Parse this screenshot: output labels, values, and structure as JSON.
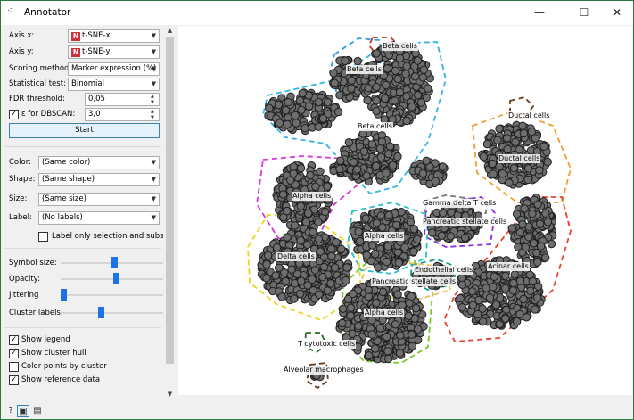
{
  "window": {
    "title": "Annotator",
    "minimize": "—",
    "maximize": "☐",
    "close": "✕"
  },
  "controls": {
    "axis_x": {
      "label": "Axis x:",
      "value": "t-SNE-x"
    },
    "axis_y": {
      "label": "Axis y:",
      "value": "t-SNE-y"
    },
    "scoring_method": {
      "label": "Scoring method:",
      "value": "Marker expression (%)"
    },
    "statistical_test": {
      "label": "Statistical test:",
      "value": "Binomial"
    },
    "fdr_threshold": {
      "label": "FDR threshold:",
      "value": "0,05"
    },
    "epsilon": {
      "label": "ε for DBSCAN:",
      "value": "3,0",
      "checked": true
    },
    "start_label": "Start"
  },
  "appearance": {
    "color": {
      "label": "Color:",
      "value": "(Same color)"
    },
    "shape": {
      "label": "Shape:",
      "value": "(Same shape)"
    },
    "size": {
      "label": "Size:",
      "value": "(Same size)"
    },
    "label": {
      "label": "Label:",
      "value": "(No labels)"
    },
    "label_only_selection": {
      "label": "Label only selection and subset",
      "checked": false
    }
  },
  "sliders": {
    "symbol_size": {
      "label": "Symbol size:",
      "level": 0.5
    },
    "opacity": {
      "label": "Opacity:",
      "level": 0.52
    },
    "jittering": {
      "label": "Jittering",
      "level": 0.0
    },
    "cluster_labels": {
      "label": "Cluster labels:",
      "level": 0.37
    }
  },
  "options": {
    "show_legend": {
      "label": "Show legend",
      "checked": true
    },
    "show_cluster_hull": {
      "label": "Show cluster hull",
      "checked": true
    },
    "color_points_by_cluster": {
      "label": "Color points by cluster",
      "checked": false
    },
    "show_reference_data": {
      "label": "Show reference data",
      "checked": true
    }
  },
  "bottom_icons": [
    "help-icon",
    "save-icon",
    "report-icon"
  ],
  "clusters": [
    {
      "name": "Beta cells",
      "hull_color": "#c0392b"
    },
    {
      "name": "Beta cells",
      "hull_color": "#2e9fd9"
    },
    {
      "name": "Beta cells",
      "hull_color": "#34b6e0"
    },
    {
      "name": "Ductal cells",
      "hull_color": "#6e3b1e"
    },
    {
      "name": "Ductal cells",
      "hull_color": "#f0a030"
    },
    {
      "name": "Alpha cells",
      "hull_color": "#d63ad6"
    },
    {
      "name": "Gamma delta T cells",
      "hull_color": "#7a7a7a"
    },
    {
      "name": "Pancreatic stellate cells",
      "hull_color": "#8b2be2"
    },
    {
      "name": "Alpha cells",
      "hull_color": "#2bc0c8"
    },
    {
      "name": "Delta cells",
      "hull_color": "#e8d81a"
    },
    {
      "name": "Acinar cells",
      "hull_color": "#e8432c"
    },
    {
      "name": "Endothelial cells",
      "hull_color": "#1a9b8f"
    },
    {
      "name": "Pancreatic stellate cells",
      "hull_color": "#e8c060"
    },
    {
      "name": "Alpha cells",
      "hull_color": "#7ac62c"
    },
    {
      "name": "T cytotoxic cells",
      "hull_color": "#2e6b2e"
    },
    {
      "name": "Alveolar macrophages",
      "hull_color": "#5a3a1a"
    }
  ]
}
